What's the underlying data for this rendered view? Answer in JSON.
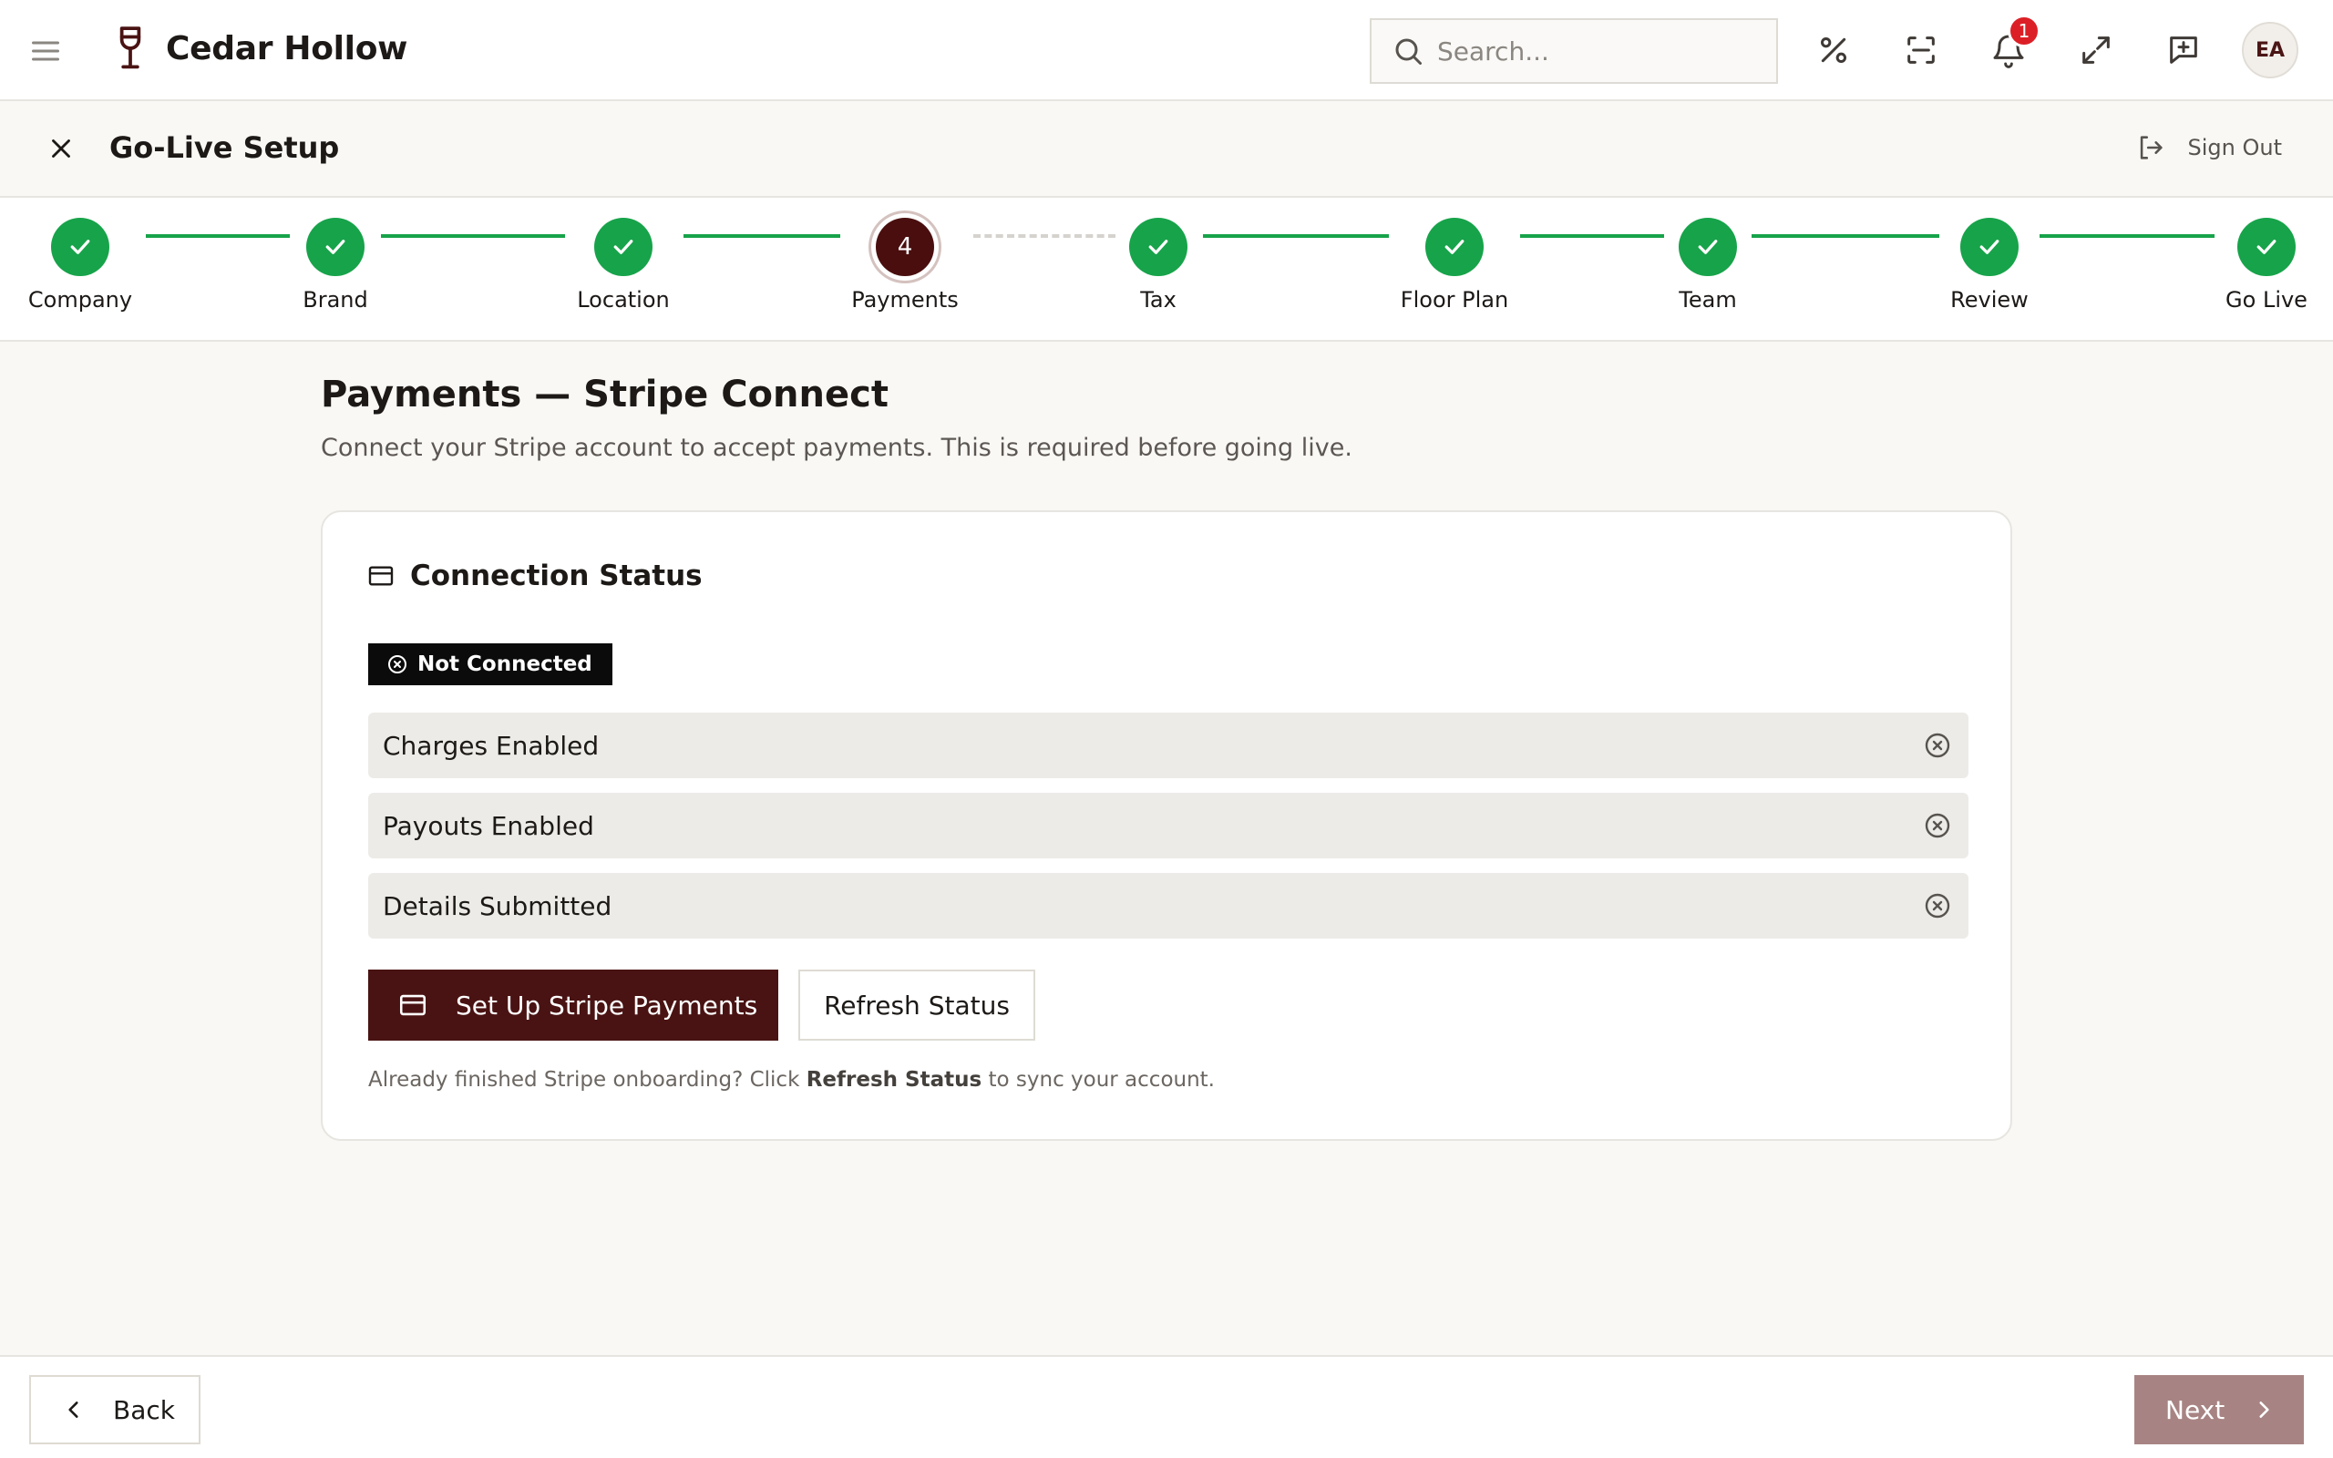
{
  "app": {
    "name": "Cedar Hollow",
    "search_placeholder": "Search...",
    "notification_count": "1",
    "user_initials": "EA"
  },
  "setup": {
    "title": "Go-Live Setup",
    "sign_out_label": "Sign Out"
  },
  "stepper": {
    "steps": [
      {
        "label": "Company",
        "state": "complete"
      },
      {
        "label": "Brand",
        "state": "complete"
      },
      {
        "label": "Location",
        "state": "complete"
      },
      {
        "label": "Payments",
        "state": "current",
        "number": "4"
      },
      {
        "label": "Tax",
        "state": "complete"
      },
      {
        "label": "Floor Plan",
        "state": "complete"
      },
      {
        "label": "Team",
        "state": "complete"
      },
      {
        "label": "Review",
        "state": "complete"
      },
      {
        "label": "Go Live",
        "state": "complete"
      }
    ]
  },
  "page": {
    "title": "Payments — Stripe Connect",
    "subtitle": "Connect your Stripe account to accept payments. This is required before going live."
  },
  "connection": {
    "card_title": "Connection Status",
    "status_badge": "Not Connected",
    "rows": [
      {
        "label": "Charges Enabled",
        "status": "not-enabled"
      },
      {
        "label": "Payouts Enabled",
        "status": "not-enabled"
      },
      {
        "label": "Details Submitted",
        "status": "not-enabled"
      }
    ],
    "primary_button": "Set Up Stripe Payments",
    "secondary_button": "Refresh Status",
    "hint_prefix": "Already finished Stripe onboarding? Click ",
    "hint_strong": "Refresh Status",
    "hint_suffix": " to sync your account."
  },
  "footer": {
    "back_label": "Back",
    "next_label": "Next"
  },
  "colors": {
    "brand": "#4a1313",
    "success": "#17a34a",
    "badge_dark": "#0b0b0b",
    "next_disabled": "#a78483",
    "notification": "#dc1f26"
  }
}
